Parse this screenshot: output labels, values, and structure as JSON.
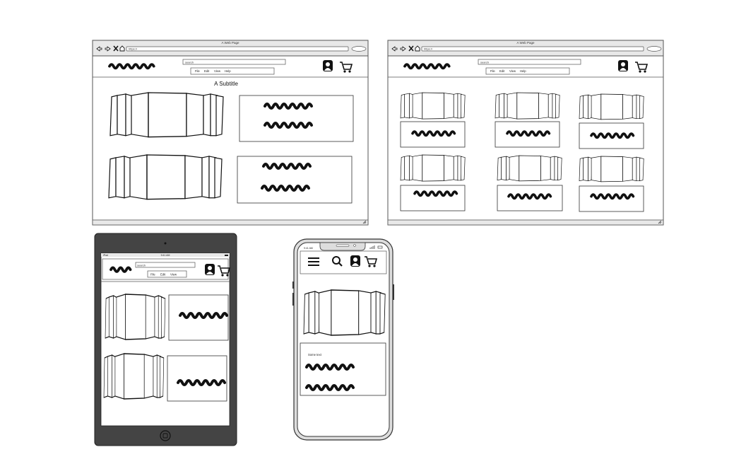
{
  "desktop_left": {
    "window_title": "A Web Page",
    "url": "https://",
    "search_value": "search",
    "menu": [
      "File",
      "Edit",
      "View",
      "Help"
    ],
    "subtitle": "A Subtitle"
  },
  "desktop_right": {
    "window_title": "A Web Page",
    "url": "https://",
    "search_value": "search",
    "menu": [
      "File",
      "Edit",
      "View",
      "Help"
    ]
  },
  "tablet": {
    "status_left": "iPad",
    "status_center": "9:41 AM",
    "search_value": "search",
    "menu": [
      "File",
      "Edit",
      "View"
    ]
  },
  "phone": {
    "status_time": "9:41 AM",
    "body_label": "Some text"
  },
  "colors": {
    "stroke": "#111111",
    "chrome": "#e8e8e8",
    "tablet_body": "#444444",
    "phone_frame": "#dddddd"
  },
  "icons": [
    "back-arrow-icon",
    "forward-arrow-icon",
    "close-icon",
    "home-icon",
    "user-icon",
    "cart-icon",
    "hamburger-menu-icon",
    "search-icon",
    "resize-grip-icon",
    "home-button-icon",
    "camera-icon"
  ]
}
